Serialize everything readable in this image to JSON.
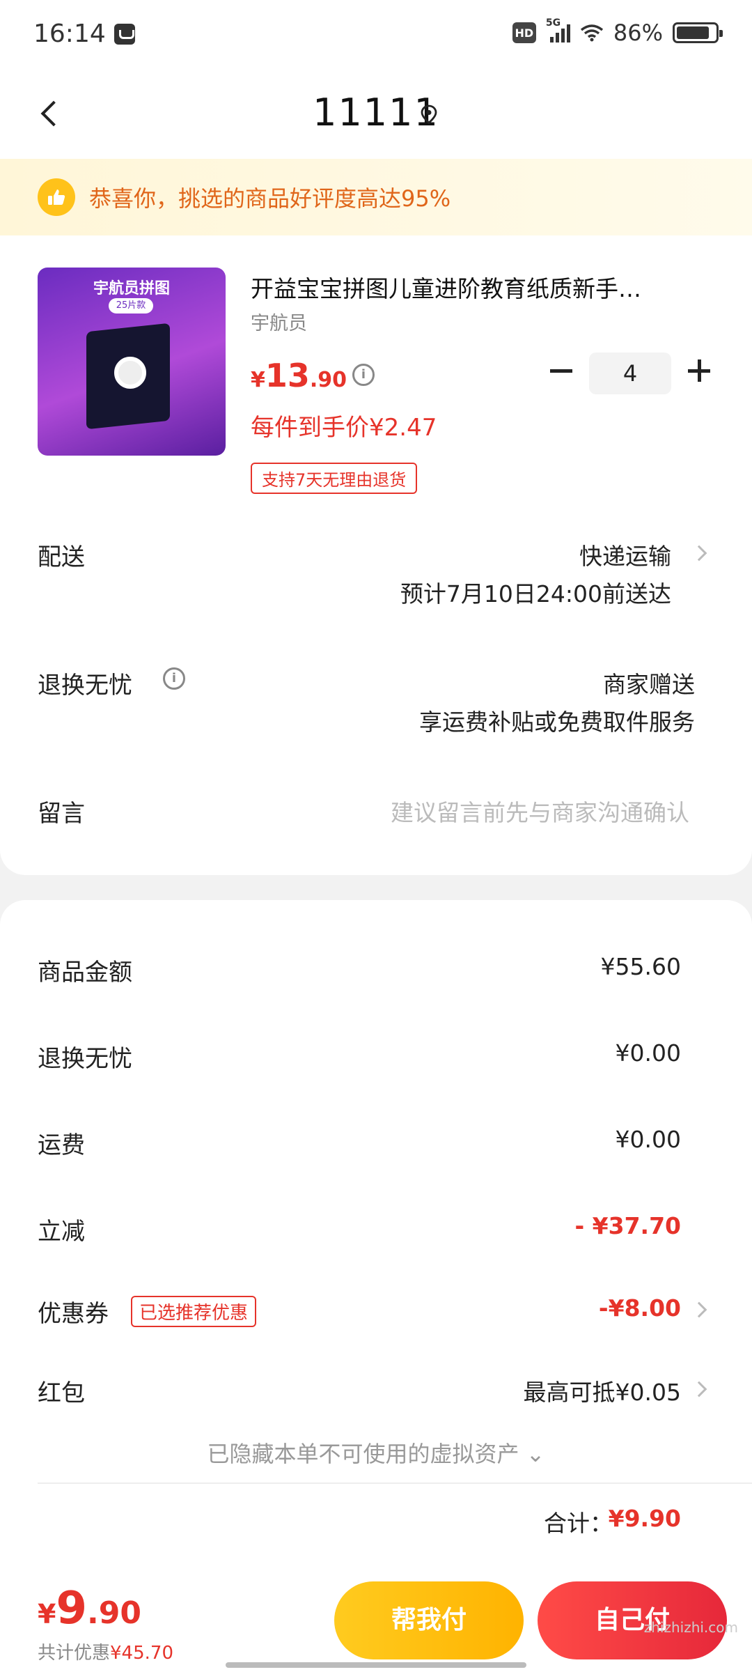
{
  "status_bar": {
    "time": "16:14",
    "hd": "HD",
    "network": "5G",
    "battery_text": "86%",
    "battery_level": 0.86
  },
  "header": {
    "title": "11111"
  },
  "banner": {
    "text": "恭喜你，挑选的商品好评度高达95%"
  },
  "product": {
    "title": "开益宝宝拼图儿童进阶教育纸质新手…",
    "spec": "宇航员",
    "image_title": "宇航员拼图",
    "image_sub": "25片款",
    "price_currency": "¥",
    "price_int": "13",
    "price_dec": ".90",
    "unit_price": "每件到手价¥2.47",
    "return_tag": "支持7天无理由退货",
    "quantity": "4"
  },
  "delivery": {
    "label": "配送",
    "method": "快递运输",
    "eta": "预计7月10日24:00前送达"
  },
  "return_worry": {
    "label": "退换无忧",
    "value": "商家赠送",
    "detail": "享运费补贴或免费取件服务"
  },
  "message": {
    "label": "留言",
    "placeholder": "建议留言前先与商家沟通确认"
  },
  "fees": {
    "goods_label": "商品金额",
    "goods_value": "¥55.60",
    "return_label": "退换无忧",
    "return_value": "¥0.00",
    "shipping_label": "运费",
    "shipping_value": "¥0.00",
    "instant_label": "立减",
    "instant_value": "- ¥37.70",
    "coupon_label": "优惠券",
    "coupon_tag": "已选推荐优惠",
    "coupon_value": "-¥8.00",
    "redpacket_label": "红包",
    "redpacket_value": "最高可抵¥0.05",
    "hidden_assets": "已隐藏本单不可使用的虚拟资产 ⌄",
    "total_label": "合计：",
    "total_value": "¥9.90"
  },
  "bottom": {
    "price_currency": "¥",
    "price_int": "9",
    "price_dec": ".90",
    "discount_label": "共计优惠",
    "discount_value": "¥45.70",
    "help_pay": "帮我付",
    "self_pay": "自己付",
    "watermark": "zhizhizhi.com"
  },
  "colors": {
    "accent_red": "#e6332a",
    "accent_yellow": "#ffc21a",
    "banner_text": "#e0661a"
  }
}
